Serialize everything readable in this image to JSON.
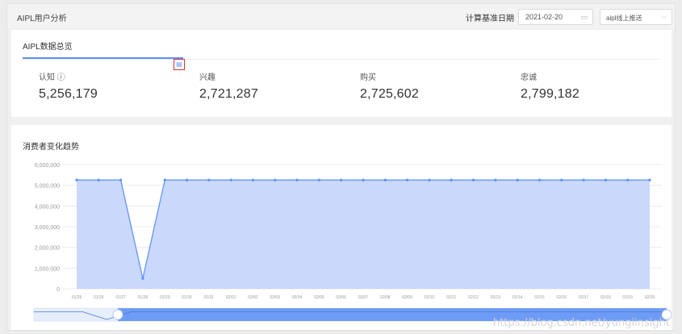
{
  "header": {
    "title": "AIPL用户分析",
    "date_label": "计算基准日期",
    "date_value": "2021-02-20",
    "channel_value": "aipl线上推送"
  },
  "overview": {
    "title": "AIPL数据总览",
    "metrics": [
      {
        "label": "认知 ⓘ",
        "value": "5,256,179"
      },
      {
        "label": "兴趣",
        "value": "2,721,287"
      },
      {
        "label": "购买",
        "value": "2,725,602"
      },
      {
        "label": "忠诚",
        "value": "2,799,182"
      }
    ]
  },
  "trend": {
    "title": "消费者变化趋势"
  },
  "watermark": "https://blog.csdn.net/yungiinsight",
  "colors": {
    "accent": "#5b8ff9",
    "area": "#c6d6fb",
    "highlight": "#e03030"
  },
  "chart_data": {
    "type": "area",
    "x": [
      "01/25",
      "01/26",
      "01/27",
      "01/28",
      "01/29",
      "01/30",
      "01/31",
      "02/01",
      "02/02",
      "02/03",
      "02/04",
      "02/05",
      "02/06",
      "02/07",
      "02/08",
      "02/09",
      "02/10",
      "02/11",
      "02/12",
      "02/13",
      "02/14",
      "02/15",
      "02/16",
      "02/17",
      "02/18",
      "02/19",
      "02/20"
    ],
    "series": [
      {
        "values": [
          5256179,
          5256179,
          5256179,
          500000,
          5256179,
          5256179,
          5256179,
          5256179,
          5256179,
          5256179,
          5256179,
          5256179,
          5256179,
          5256179,
          5256179,
          5256179,
          5256179,
          5256179,
          5256179,
          5256179,
          5256179,
          5256179,
          5256179,
          5256179,
          5256179,
          5256179,
          5256179
        ]
      }
    ],
    "yticks": [
      "6,000,000",
      "5,000,000",
      "4,000,000",
      "3,000,000",
      "2,000,000",
      "1,000,000",
      "0"
    ],
    "ylim": [
      0,
      6000000
    ],
    "grid": true,
    "legend": "none"
  }
}
